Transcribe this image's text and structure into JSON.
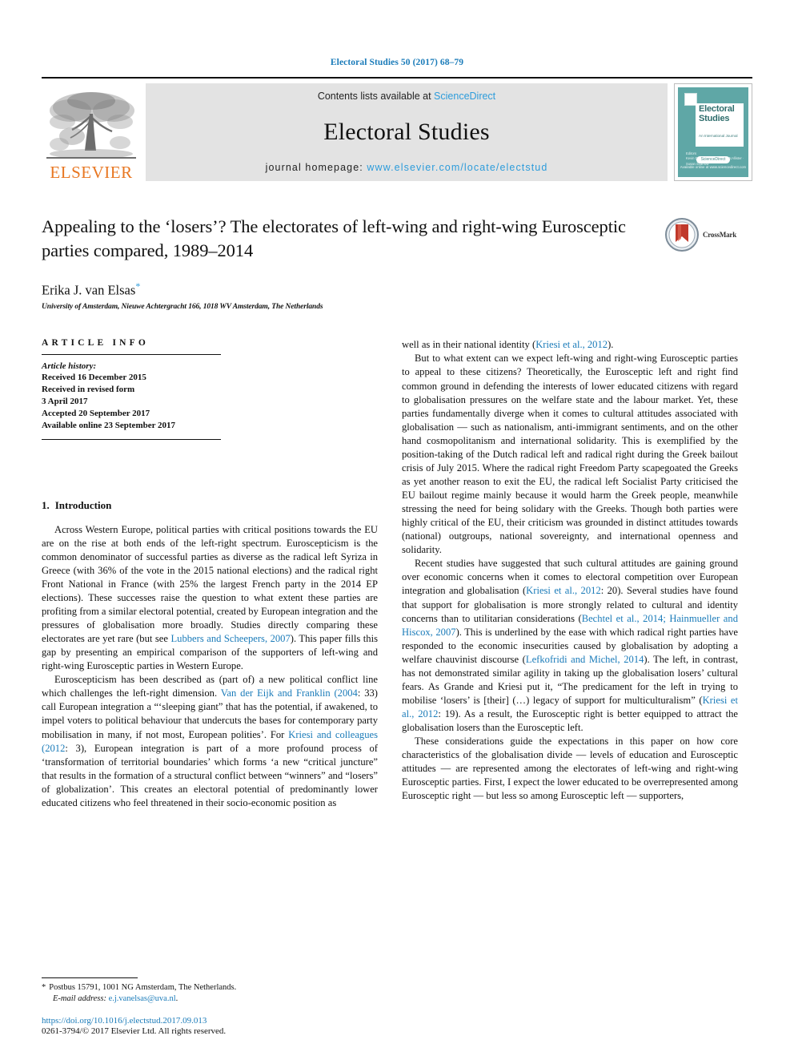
{
  "running_head": "Electoral Studies 50 (2017) 68–79",
  "masthead": {
    "publisher_name": "ELSEVIER",
    "contents_prefix": "Contents lists available at ",
    "sciencedirect": "ScienceDirect",
    "journal_name": "Electoral Studies",
    "homepage_prefix": "journal homepage: ",
    "homepage_url": "www.elsevier.com/locate/electstud",
    "cover": {
      "title_line1": "Electoral",
      "title_line2": "Studies",
      "subtitle": "An International Journal",
      "editor_label": "Editors",
      "editors": "Kevin Deegan-Krause · Ian McAllister · Susan Scarrow",
      "badge": "ScienceDirect",
      "footer": "Available online at www.sciencedirect.com"
    }
  },
  "article": {
    "title": "Appealing to the ‘losers’? The electorates of left-wing and right-wing Eurosceptic parties compared, 1989–2014",
    "author": "Erika J. van Elsas",
    "author_marker": "*",
    "affiliation": "University of Amsterdam, Nieuwe Achtergracht 166, 1018 WV Amsterdam, The Netherlands",
    "crossmark_label": "CrossMark"
  },
  "article_info": {
    "heading": "ARTICLE INFO",
    "history_label": "Article history:",
    "history": [
      "Received 16 December 2015",
      "Received in revised form",
      "3 April 2017",
      "Accepted 20 September 2017",
      "Available online 23 September 2017"
    ]
  },
  "sections": {
    "introduction": {
      "number": "1.",
      "title": "Introduction"
    }
  },
  "left_column": {
    "paragraphs": [
      {
        "id": "p1",
        "runs": [
          {
            "t": "Across Western Europe, political parties with critical positions towards the EU are on the rise at both ends of the left-right spectrum. Euroscepticism is the common denominator of successful parties as diverse as the radical left Syriza in Greece (with 36% of the vote in the 2015 national elections) and the radical right Front National in France (with 25% the largest French party in the 2014 EP elections). These successes raise the question to what extent these parties are profiting from a similar electoral potential, created by European integration and the pressures of globalisation more broadly. Studies directly comparing these electorates are yet rare (but see "
          },
          {
            "t": "Lubbers and Scheepers, 2007",
            "cite": true
          },
          {
            "t": "). This paper fills this gap by presenting an empirical comparison of the supporters of left-wing and right-wing Eurosceptic parties in Western Europe."
          }
        ]
      },
      {
        "id": "p2",
        "runs": [
          {
            "t": "Euroscepticism has been described as (part of) a new political conflict line which challenges the left-right dimension. "
          },
          {
            "t": "Van der Eijk and Franklin (2004",
            "cite": true
          },
          {
            "t": ": 33) call European integration a “‘sleeping giant” that has the potential, if awakened, to impel voters to political behaviour that undercuts the bases for contemporary party mobilisation in many, if not most, European polities’. For "
          },
          {
            "t": "Kriesi and colleagues (2012",
            "cite": true
          },
          {
            "t": ": 3), European integration is part of a more profound process of ‘transformation of territorial boundaries’ which forms ‘a new “critical juncture” that results in the formation of a structural conflict between “winners” and “losers” of globalization’. This creates an electoral potential of predominantly lower educated citizens who feel threatened in their socio-economic position as"
          }
        ]
      }
    ]
  },
  "right_column": {
    "paragraphs": [
      {
        "id": "rp0",
        "indent": false,
        "runs": [
          {
            "t": "well as in their national identity ("
          },
          {
            "t": "Kriesi et al., 2012",
            "cite": true
          },
          {
            "t": ")."
          }
        ]
      },
      {
        "id": "rp1",
        "indent": true,
        "runs": [
          {
            "t": "But to what extent can we expect left-wing and right-wing Eurosceptic parties to appeal to these citizens? Theoretically, the Eurosceptic left and right find common ground in defending the interests of lower educated citizens with regard to globalisation pressures on the welfare state and the labour market. Yet, these parties fundamentally diverge when it comes to cultural attitudes associated with globalisation — such as nationalism, anti-immigrant sentiments, and on the other hand cosmopolitanism and international solidarity. This is exemplified by the position-taking of the Dutch radical left and radical right during the Greek bailout crisis of July 2015. Where the radical right Freedom Party scapegoated the Greeks as yet another reason to exit the EU, the radical left Socialist Party criticised the EU bailout regime mainly because it would harm the Greek people, meanwhile stressing the need for being solidary with the Greeks. Though both parties were highly critical of the EU, their criticism was grounded in distinct attitudes towards (national) outgroups, national sovereignty, and international openness and solidarity."
          }
        ]
      },
      {
        "id": "rp2",
        "indent": true,
        "runs": [
          {
            "t": "Recent studies have suggested that such cultural attitudes are gaining ground over economic concerns when it comes to electoral competition over European integration and globalisation ("
          },
          {
            "t": "Kriesi et al., 2012",
            "cite": true
          },
          {
            "t": ": 20). Several studies have found that support for globalisation is more strongly related to cultural and identity concerns than to utilitarian considerations ("
          },
          {
            "t": "Bechtel et al., 2014; Hainmueller and Hiscox, 2007",
            "cite": true
          },
          {
            "t": "). This is underlined by the ease with which radical right parties have responded to the economic insecurities caused by globalisation by adopting a welfare chauvinist discourse ("
          },
          {
            "t": "Lefkofridi and Michel, 2014",
            "cite": true
          },
          {
            "t": "). The left, in contrast, has not demonstrated similar agility in taking up the globalisation losers’ cultural fears. As Grande and Kriesi put it, “The predicament for the left in trying to mobilise ‘losers’ is [their] (…) legacy of support for multiculturalism” ("
          },
          {
            "t": "Kriesi et al., 2012",
            "cite": true
          },
          {
            "t": ": 19). As a result, the Eurosceptic right is better equipped to attract the globalisation losers than the Eurosceptic left."
          }
        ]
      },
      {
        "id": "rp3",
        "indent": true,
        "runs": [
          {
            "t": "These considerations guide the expectations in this paper on how core characteristics of the globalisation divide — levels of education and Eurosceptic attitudes — are represented among the electorates of left-wing and right-wing Eurosceptic parties. First, I expect the lower educated to be overrepresented among Eurosceptic right — but less so among Eurosceptic left — supporters,"
          }
        ]
      }
    ]
  },
  "footnote": {
    "marker": "*",
    "address": "Postbus 15791, 1001 NG Amsterdam, The Netherlands.",
    "email_label": "E-mail address:",
    "email": "e.j.vanelsas@uva.nl",
    "email_suffix": ".",
    "doi": "https://doi.org/10.1016/j.electstud.2017.09.013",
    "copyright": "0261-3794/© 2017 Elsevier Ltd. All rights reserved."
  },
  "colors": {
    "link": "#1a7bb9",
    "sciencedirect": "#2d9cdb",
    "elsevier_orange": "#E87722",
    "banner_gray": "#e3e3e3",
    "cover_teal": "#5fa7a6",
    "crossmark_red": "#c0392b"
  }
}
